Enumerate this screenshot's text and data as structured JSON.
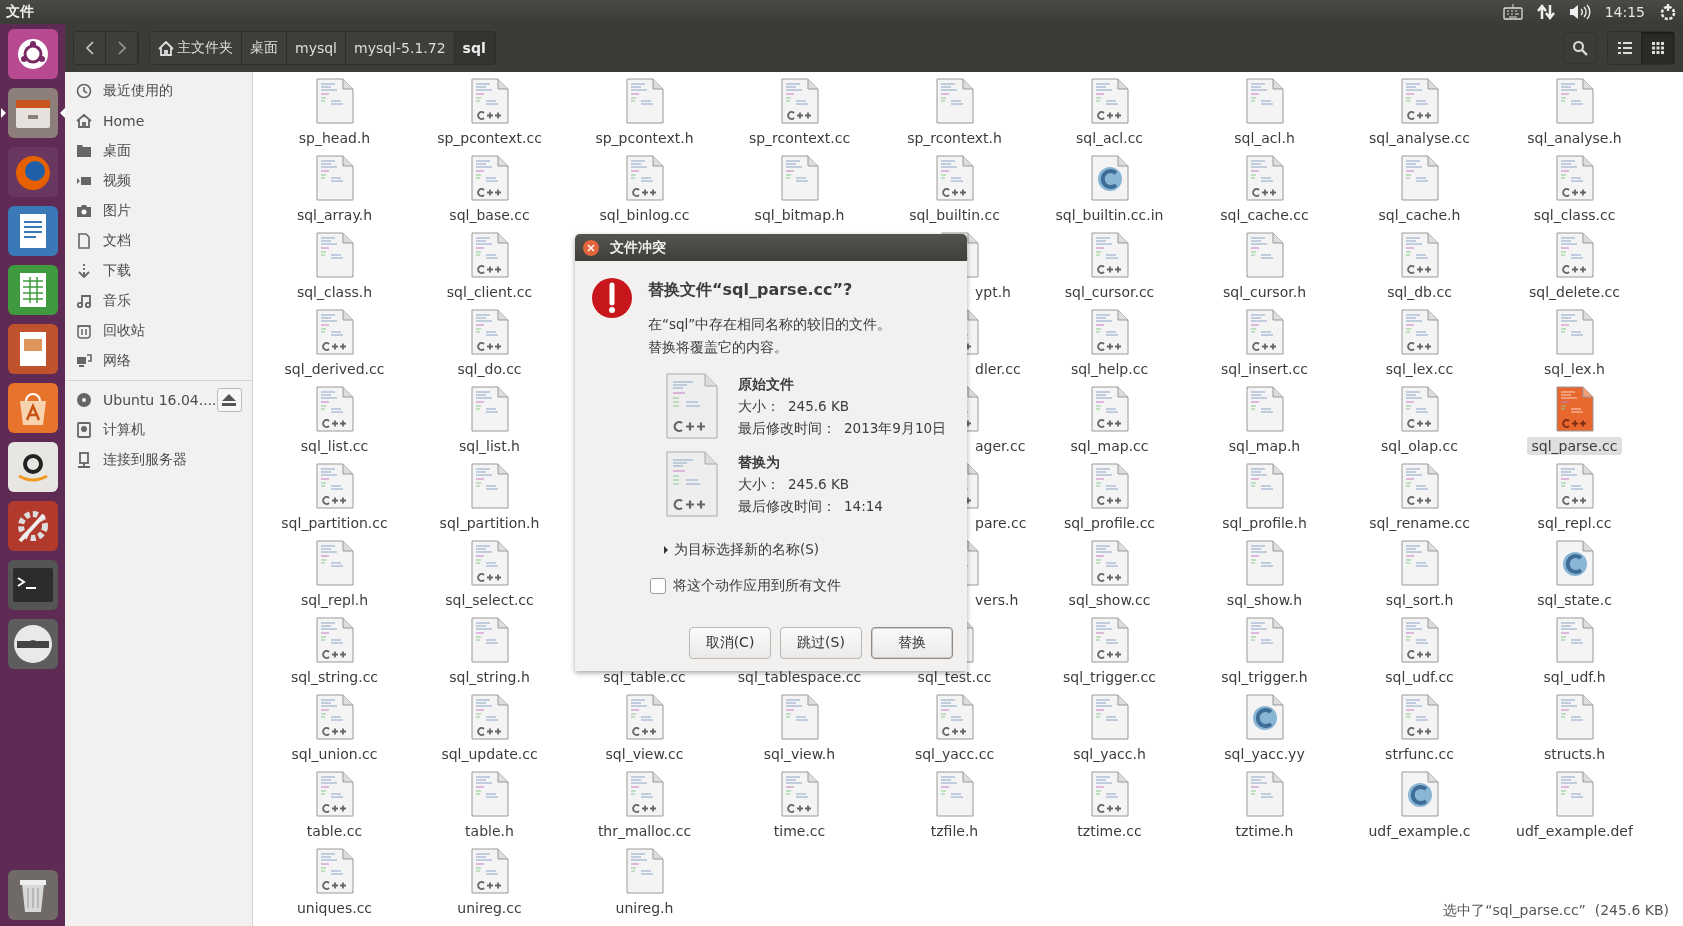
{
  "top_panel": {
    "app_title": "文件",
    "clock": "14:15"
  },
  "launcher": [
    {
      "kind": "dash",
      "focused": false
    },
    {
      "kind": "files",
      "focused": true
    },
    {
      "kind": "firefox",
      "focused": false
    },
    {
      "kind": "writer",
      "focused": false
    },
    {
      "kind": "calc",
      "focused": false
    },
    {
      "kind": "impress",
      "focused": false
    },
    {
      "kind": "software",
      "focused": false
    },
    {
      "kind": "amazon",
      "focused": false
    },
    {
      "kind": "settings",
      "focused": false
    },
    {
      "kind": "terminal",
      "focused": false
    },
    {
      "kind": "dvd",
      "focused": false
    },
    {
      "kind": "trash",
      "focused": false
    }
  ],
  "path_bar": [
    {
      "label": "主文件夹",
      "home": true,
      "selected": false
    },
    {
      "label": "桌面",
      "home": false,
      "selected": false
    },
    {
      "label": "mysql",
      "home": false,
      "selected": false
    },
    {
      "label": "mysql-5.1.72",
      "home": false,
      "selected": false
    },
    {
      "label": "sql",
      "home": false,
      "selected": true
    }
  ],
  "view_switch": [
    {
      "kind": "list",
      "selected": false
    },
    {
      "kind": "grid",
      "selected": true
    }
  ],
  "sidebar": {
    "places": [
      {
        "kind": "clock",
        "label": "最近使用的"
      },
      {
        "kind": "home",
        "label": "Home"
      },
      {
        "kind": "folder",
        "label": "桌面"
      },
      {
        "kind": "video",
        "label": "视频"
      },
      {
        "kind": "camera",
        "label": "图片"
      },
      {
        "kind": "document",
        "label": "文档"
      },
      {
        "kind": "download",
        "label": "下载"
      },
      {
        "kind": "music",
        "label": "音乐"
      },
      {
        "kind": "trash",
        "label": "回收站"
      },
      {
        "kind": "network",
        "label": "网络"
      }
    ],
    "devices": [
      {
        "kind": "disc",
        "label": "Ubuntu 16.04....",
        "eject": true
      },
      {
        "kind": "drive",
        "label": "计算机",
        "eject": false
      },
      {
        "kind": "server",
        "label": "连接到服务器",
        "eject": false
      }
    ]
  },
  "rows": [
    {
      "left": [
        {
          "name": "sp_head.h",
          "kind": "h",
          "selected": false
        },
        {
          "name": "sp_pcontext.cc",
          "kind": "cpp",
          "selected": false
        },
        {
          "name": "sp_pcontext.h",
          "kind": "h",
          "selected": false
        },
        {
          "name": "sp_rcontext.cc",
          "kind": "cpp",
          "selected": false
        },
        {
          "name": "sp_rcontext.h",
          "kind": "h",
          "selected": false
        },
        {
          "name": "sql_acl.cc",
          "kind": "cpp",
          "selected": false
        },
        {
          "name": "sql_acl.h",
          "kind": "h",
          "selected": false
        },
        {
          "name": "sql_analyse.cc",
          "kind": "cpp",
          "selected": false
        },
        {
          "name": "sql_analyse.h",
          "kind": "h",
          "selected": false
        }
      ],
      "right": []
    },
    {
      "left": [
        {
          "name": "sql_array.h",
          "kind": "h",
          "selected": false
        },
        {
          "name": "sql_base.cc",
          "kind": "cpp",
          "selected": false
        },
        {
          "name": "sql_binlog.cc",
          "kind": "cpp",
          "selected": false
        },
        {
          "name": "sql_bitmap.h",
          "kind": "h",
          "selected": false
        },
        {
          "name": "sql_builtin.cc",
          "kind": "cpp",
          "selected": false
        },
        {
          "name": "sql_builtin.cc.in",
          "kind": "c",
          "selected": false
        },
        {
          "name": "sql_cache.cc",
          "kind": "cpp",
          "selected": false
        },
        {
          "name": "sql_cache.h",
          "kind": "h",
          "selected": false
        },
        {
          "name": "sql_class.cc",
          "kind": "cpp",
          "selected": false
        }
      ],
      "right": []
    },
    {
      "left": [
        {
          "name": "sql_class.h",
          "kind": "h",
          "selected": false
        },
        {
          "name": "sql_client.cc",
          "kind": "cpp",
          "selected": false
        }
      ],
      "right": [
        {
          "name": "ypt.h",
          "kind": "h",
          "selected": false,
          "partial": true
        },
        {
          "name": "sql_cursor.cc",
          "kind": "cpp",
          "selected": false
        },
        {
          "name": "sql_cursor.h",
          "kind": "h",
          "selected": false
        },
        {
          "name": "sql_db.cc",
          "kind": "cpp",
          "selected": false
        },
        {
          "name": "sql_delete.cc",
          "kind": "cpp",
          "selected": false
        }
      ]
    },
    {
      "left": [
        {
          "name": "sql_derived.cc",
          "kind": "cpp",
          "selected": false
        },
        {
          "name": "sql_do.cc",
          "kind": "cpp",
          "selected": false
        }
      ],
      "right": [
        {
          "name": "dler.cc",
          "kind": "cpp",
          "selected": false,
          "partial": true
        },
        {
          "name": "sql_help.cc",
          "kind": "cpp",
          "selected": false
        },
        {
          "name": "sql_insert.cc",
          "kind": "cpp",
          "selected": false
        },
        {
          "name": "sql_lex.cc",
          "kind": "cpp",
          "selected": false
        },
        {
          "name": "sql_lex.h",
          "kind": "h",
          "selected": false
        }
      ]
    },
    {
      "left": [
        {
          "name": "sql_list.cc",
          "kind": "cpp",
          "selected": false
        },
        {
          "name": "sql_list.h",
          "kind": "h",
          "selected": false
        }
      ],
      "right": [
        {
          "name": "ager.cc",
          "kind": "cpp",
          "selected": false,
          "partial": true
        },
        {
          "name": "sql_map.cc",
          "kind": "cpp",
          "selected": false
        },
        {
          "name": "sql_map.h",
          "kind": "h",
          "selected": false
        },
        {
          "name": "sql_olap.cc",
          "kind": "cpp",
          "selected": false
        },
        {
          "name": "sql_parse.cc",
          "kind": "cpp",
          "selected": true
        }
      ]
    },
    {
      "left": [
        {
          "name": "sql_partition.cc",
          "kind": "cpp",
          "selected": false
        },
        {
          "name": "sql_partition.h",
          "kind": "h",
          "selected": false
        }
      ],
      "right": [
        {
          "name": "pare.cc",
          "kind": "cpp",
          "selected": false,
          "partial": true
        },
        {
          "name": "sql_profile.cc",
          "kind": "cpp",
          "selected": false
        },
        {
          "name": "sql_profile.h",
          "kind": "h",
          "selected": false
        },
        {
          "name": "sql_rename.cc",
          "kind": "cpp",
          "selected": false
        },
        {
          "name": "sql_repl.cc",
          "kind": "cpp",
          "selected": false
        }
      ]
    },
    {
      "left": [
        {
          "name": "sql_repl.h",
          "kind": "h",
          "selected": false
        },
        {
          "name": "sql_select.cc",
          "kind": "cpp",
          "selected": false
        }
      ],
      "right": [
        {
          "name": "vers.h",
          "kind": "h",
          "selected": false,
          "partial": true
        },
        {
          "name": "sql_show.cc",
          "kind": "cpp",
          "selected": false
        },
        {
          "name": "sql_show.h",
          "kind": "h",
          "selected": false
        },
        {
          "name": "sql_sort.h",
          "kind": "h",
          "selected": false
        },
        {
          "name": "sql_state.c",
          "kind": "c",
          "selected": false
        }
      ]
    },
    {
      "left": [
        {
          "name": "sql_string.cc",
          "kind": "cpp",
          "selected": false
        },
        {
          "name": "sql_string.h",
          "kind": "h",
          "selected": false
        },
        {
          "name": "sql_table.cc",
          "selected": false
        },
        {
          "name": "sql_tablespace.cc",
          "selected": false
        },
        {
          "name": "sql_test.cc",
          "kind": "cpp",
          "selected": false
        },
        {
          "name": "sql_trigger.cc",
          "kind": "cpp",
          "selected": false
        },
        {
          "name": "sql_trigger.h",
          "kind": "h",
          "selected": false
        },
        {
          "name": "sql_udf.cc",
          "kind": "cpp",
          "selected": false
        },
        {
          "name": "sql_udf.h",
          "kind": "h",
          "selected": false
        }
      ],
      "right": []
    },
    {
      "left": [
        {
          "name": "sql_union.cc",
          "kind": "cpp",
          "selected": false
        },
        {
          "name": "sql_update.cc",
          "kind": "cpp",
          "selected": false
        },
        {
          "name": "sql_view.cc",
          "kind": "cpp",
          "selected": false
        },
        {
          "name": "sql_view.h",
          "kind": "h",
          "selected": false
        },
        {
          "name": "sql_yacc.cc",
          "kind": "cpp",
          "selected": false
        },
        {
          "name": "sql_yacc.h",
          "kind": "h",
          "selected": false
        },
        {
          "name": "sql_yacc.yy",
          "kind": "c",
          "selected": false
        },
        {
          "name": "strfunc.cc",
          "kind": "cpp",
          "selected": false
        },
        {
          "name": "structs.h",
          "kind": "h",
          "selected": false
        }
      ],
      "right": []
    },
    {
      "left": [
        {
          "name": "table.cc",
          "kind": "cpp",
          "selected": false
        },
        {
          "name": "table.h",
          "kind": "h",
          "selected": false
        },
        {
          "name": "thr_malloc.cc",
          "kind": "cpp",
          "selected": false
        },
        {
          "name": "time.cc",
          "kind": "cpp",
          "selected": false
        },
        {
          "name": "tzfile.h",
          "kind": "h",
          "selected": false
        },
        {
          "name": "tztime.cc",
          "kind": "cpp",
          "selected": false
        },
        {
          "name": "tztime.h",
          "kind": "h",
          "selected": false
        },
        {
          "name": "udf_example.c",
          "kind": "c",
          "selected": false
        },
        {
          "name": "udf_example.def",
          "kind": "text",
          "selected": false
        }
      ],
      "right": []
    },
    {
      "left": [
        {
          "name": "uniques.cc",
          "kind": "cpp",
          "selected": false
        },
        {
          "name": "unireg.cc",
          "kind": "cpp",
          "selected": false
        },
        {
          "name": "unireg.h",
          "kind": "h",
          "selected": false
        }
      ],
      "right": []
    }
  ],
  "status": "选中了“sql_parse.cc”  (245.6 KB)",
  "dialog": {
    "title": "文件冲突",
    "heading": "替换文件“sql_parse.cc”?",
    "message": [
      "在“sql”中存在相同名称的较旧的文件。",
      "替换将覆盖它的内容。"
    ],
    "files": [
      {
        "title": "原始文件",
        "size_label": "大小：",
        "size": "245.6 KB",
        "mtime_label": "最后修改时间：",
        "mtime": "2013年9月10日"
      },
      {
        "title": "替换为",
        "size_label": "大小：",
        "size": "245.6 KB",
        "mtime_label": "最后修改时间：",
        "mtime": "14:14"
      }
    ],
    "expander": {
      "label": "为目标选择新的名称(S)",
      "expanded": false
    },
    "checkbox": {
      "label": "将这个动作应用到所有文件",
      "checked": false
    },
    "buttons": [
      {
        "label": "取消(C)",
        "default": false
      },
      {
        "label": "跳过(S)",
        "default": false
      },
      {
        "label": "替换",
        "default": true
      }
    ]
  }
}
